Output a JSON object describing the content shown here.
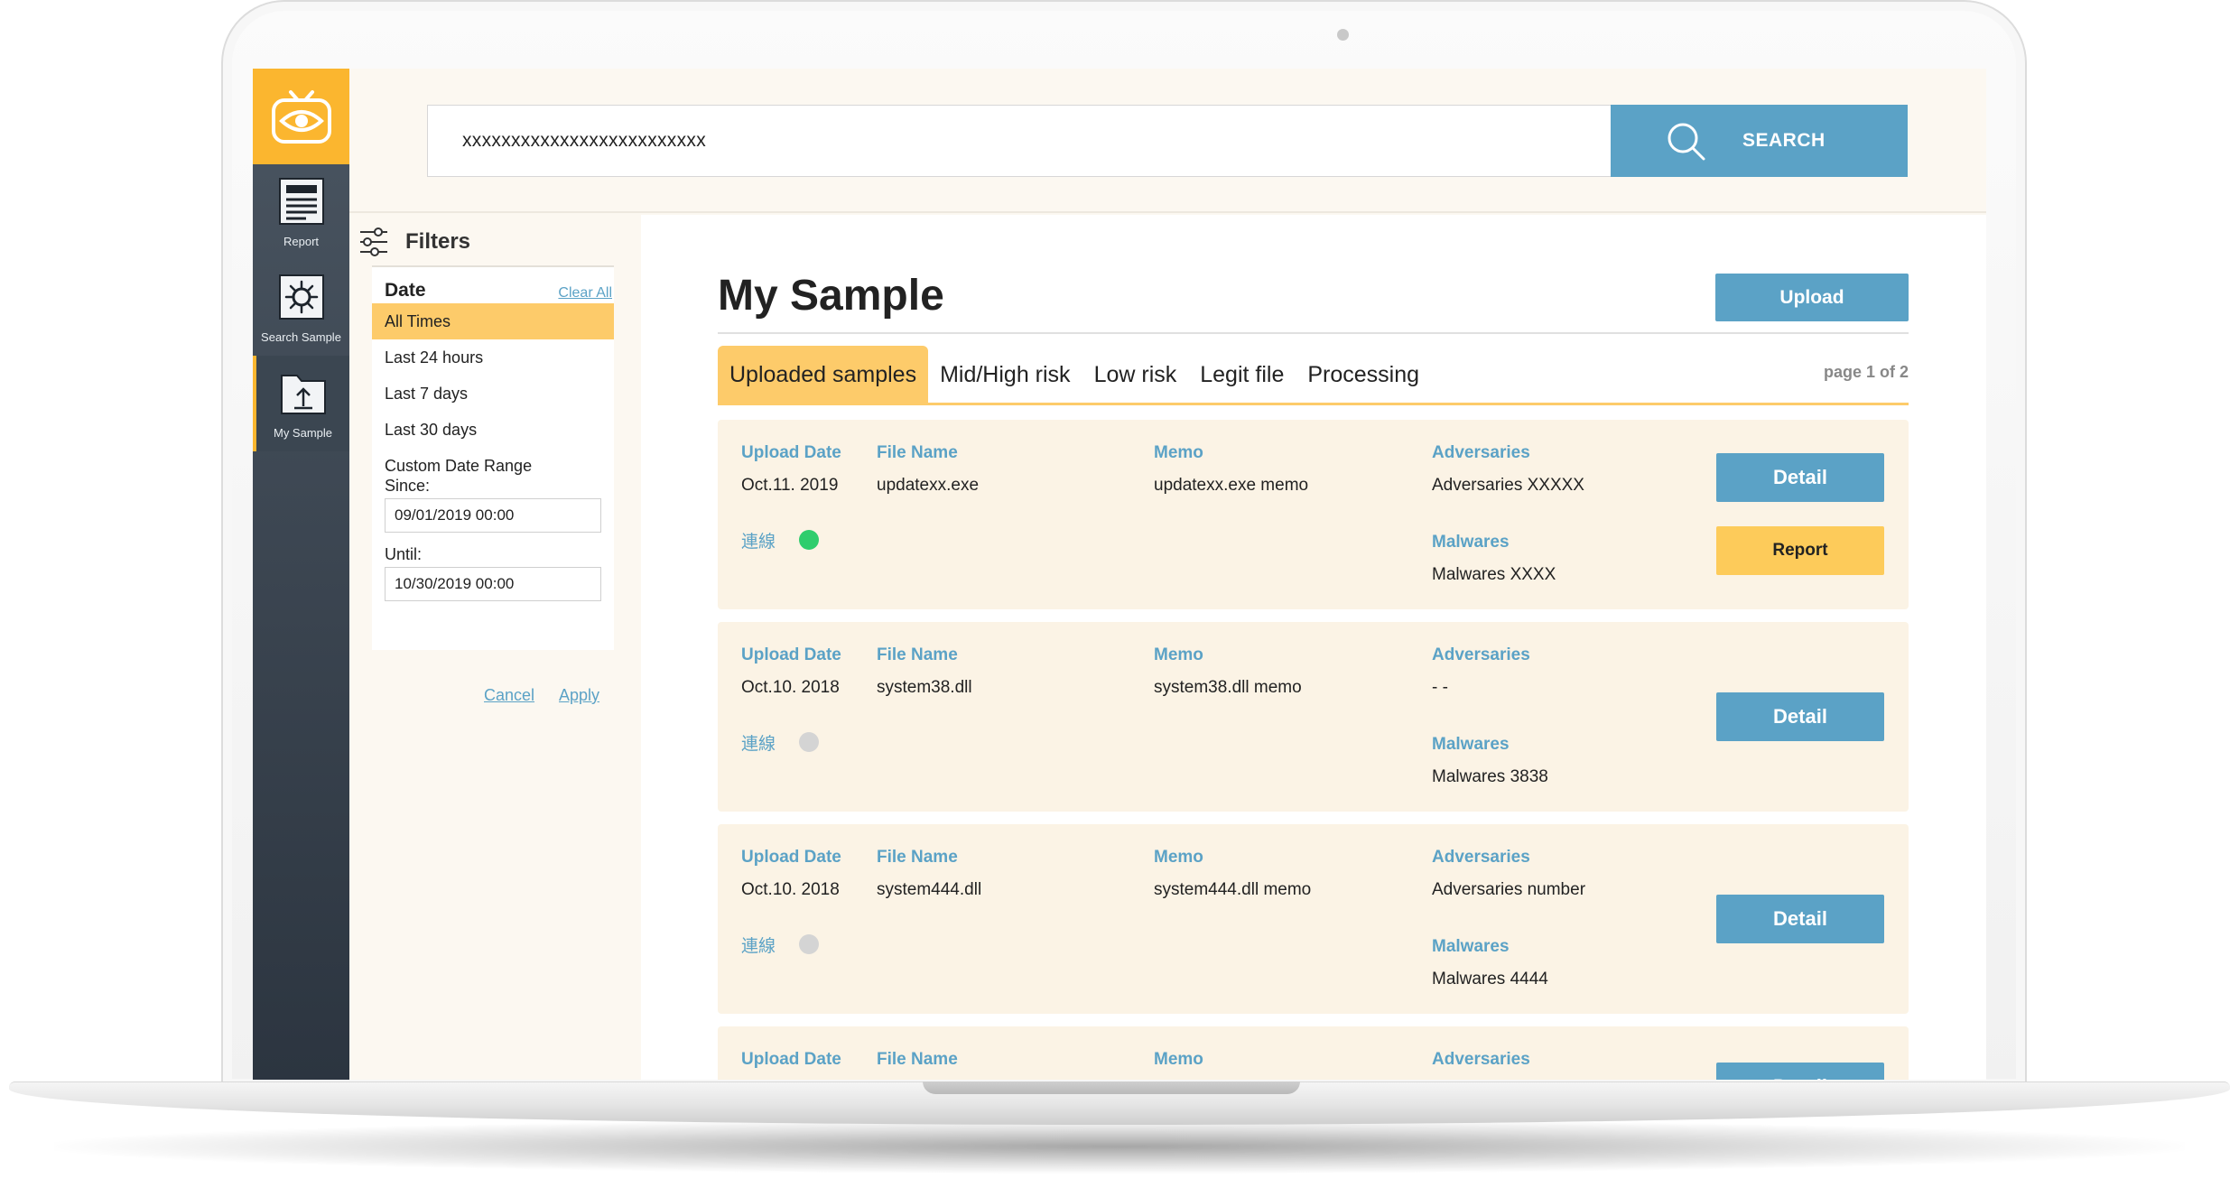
{
  "sidebar": {
    "logo_icon": "eye-tv-logo",
    "items": [
      {
        "label": "Report",
        "icon": "report-doc-icon"
      },
      {
        "label": "Search Sample",
        "icon": "virus-search-icon"
      },
      {
        "label": "My Sample",
        "icon": "upload-folder-icon",
        "active": true
      }
    ]
  },
  "search": {
    "value": "xxxxxxxxxxxxxxxxxxxxxxxxx",
    "button_label": "SEARCH",
    "icon": "search-icon"
  },
  "filters": {
    "title": "Filters",
    "icon": "sliders-icon",
    "section": "Date",
    "clear_all": "Clear All",
    "options": [
      "All Times",
      "Last 24 hours",
      "Last 7 days",
      "Last 30 days"
    ],
    "selected": "All Times",
    "custom_label": "Custom Date Range",
    "since_label": "Since:",
    "since_value": "09/01/2019 00:00",
    "until_label": "Until:",
    "until_value": "10/30/2019 00:00",
    "cancel": "Cancel",
    "apply": "Apply"
  },
  "main": {
    "title": "My Sample",
    "upload_label": "Upload",
    "tabs": [
      "Uploaded samples",
      "Mid/High risk",
      "Low risk",
      "Legit file",
      "Processing"
    ],
    "active_tab": "Uploaded samples",
    "page_info": "page 1 of 2",
    "headers": {
      "upload_date": "Upload Date",
      "file_name": "File Name",
      "memo": "Memo",
      "adversaries": "Adversaries",
      "malwares": "Malwares"
    },
    "connection_label": "連線",
    "detail_label": "Detail",
    "report_label": "Report",
    "samples": [
      {
        "date": "Oct.11. 2019",
        "file": "updatexx.exe",
        "memo": "updatexx.exe memo",
        "adversaries": "Adversaries XXXXX",
        "malwares": "Malwares XXXX",
        "connected": true,
        "has_report": true
      },
      {
        "date": "Oct.10. 2018",
        "file": "system38.dll",
        "memo": "system38.dll memo",
        "adversaries": "- -",
        "malwares": "Malwares 3838",
        "connected": false,
        "has_report": false
      },
      {
        "date": "Oct.10. 2018",
        "file": "system444.dll",
        "memo": "system444.dll memo",
        "adversaries": "Adversaries number",
        "malwares": "Malwares 4444",
        "connected": false,
        "has_report": false
      }
    ]
  },
  "colors": {
    "accent_blue": "#5ba2c6",
    "accent_yellow": "#fdcb6a",
    "logo_yellow": "#fbb62f",
    "sidebar_dark": "#2c3540",
    "connected_green": "#2fcd6d",
    "disconnected_gray": "#d4d4d4",
    "card_bg": "#fbf3e5"
  }
}
